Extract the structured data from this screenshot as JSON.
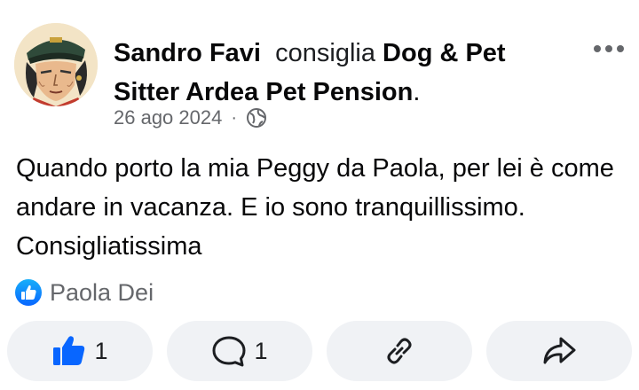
{
  "post": {
    "author": "Sandro Favi",
    "verb": "consiglia",
    "page": "Dog & Pet Sitter Ardea Pet Pension",
    "page_suffix": ".",
    "date": "26 ago 2024",
    "separator": "·",
    "audience_icon": "globe-icon",
    "text": "Quando porto la mia Peggy da Paola, per lei è come andare in vacanza. E io sono tranquillissimo. Consigliatissima"
  },
  "reactions": {
    "icon": "like-badge-icon",
    "names": "Paola Dei"
  },
  "actions": {
    "like_count": "1",
    "comment_count": "1"
  },
  "colors": {
    "accent": "#0866ff",
    "muted": "#65676b",
    "button_bg": "#f0f2f5"
  }
}
